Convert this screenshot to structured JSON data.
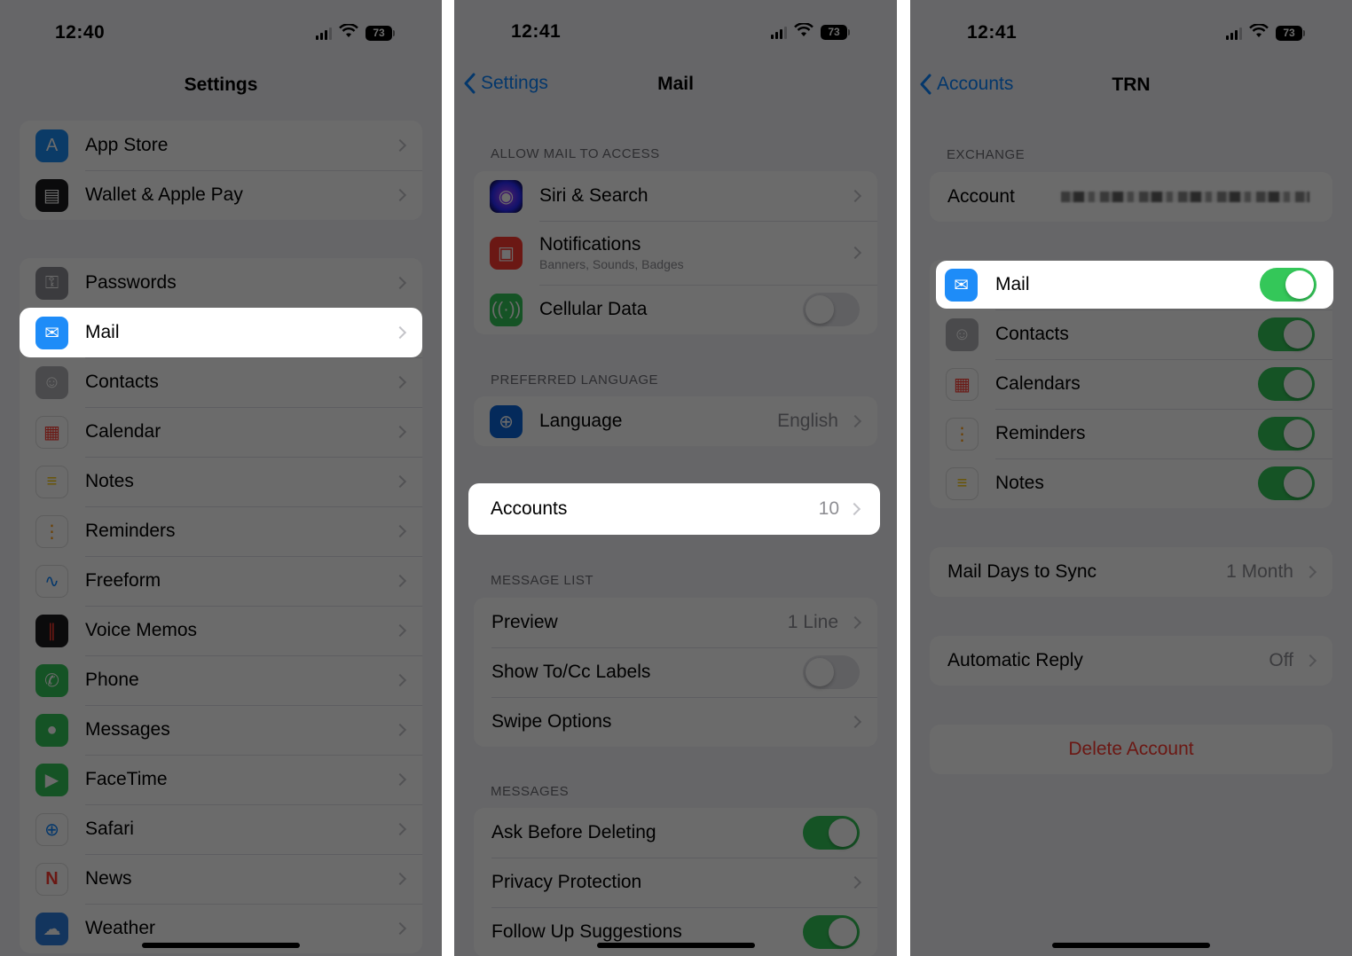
{
  "panel1": {
    "time": "12:40",
    "battery": "73",
    "title": "Settings",
    "items": [
      {
        "label": "App Store",
        "icon": "app-store-icon",
        "color": "#1c8cf6",
        "glyph": "A"
      },
      {
        "label": "Wallet & Apple Pay",
        "icon": "wallet-icon",
        "color": "#1c1c1e",
        "glyph": "▤"
      },
      {
        "label": "Passwords",
        "icon": "key-icon",
        "color": "#8e8e93",
        "glyph": "⚿"
      },
      {
        "label": "Mail",
        "icon": "mail-icon",
        "color": "#1e8cf8",
        "glyph": "✉"
      },
      {
        "label": "Contacts",
        "icon": "contacts-icon",
        "color": "#b0b0b5",
        "glyph": "☺"
      },
      {
        "label": "Calendar",
        "icon": "calendar-icon",
        "color": "#ffffff",
        "glyph": "▦"
      },
      {
        "label": "Notes",
        "icon": "notes-icon",
        "color": "#ffffff",
        "glyph": "≡"
      },
      {
        "label": "Reminders",
        "icon": "reminders-icon",
        "color": "#ffffff",
        "glyph": "⋮"
      },
      {
        "label": "Freeform",
        "icon": "freeform-icon",
        "color": "#ffffff",
        "glyph": "∿"
      },
      {
        "label": "Voice Memos",
        "icon": "voice-memos-icon",
        "color": "#1c1c1e",
        "glyph": "∥"
      },
      {
        "label": "Phone",
        "icon": "phone-icon",
        "color": "#34c759",
        "glyph": "✆"
      },
      {
        "label": "Messages",
        "icon": "messages-icon",
        "color": "#34c759",
        "glyph": "●"
      },
      {
        "label": "FaceTime",
        "icon": "facetime-icon",
        "color": "#34c759",
        "glyph": "▶"
      },
      {
        "label": "Safari",
        "icon": "safari-icon",
        "color": "#ffffff",
        "glyph": "⊕"
      },
      {
        "label": "News",
        "icon": "news-icon",
        "color": "#ffffff",
        "glyph": "N"
      },
      {
        "label": "Weather",
        "icon": "weather-icon",
        "color": "#2f7fe0",
        "glyph": "☁"
      }
    ]
  },
  "panel2": {
    "time": "12:41",
    "battery": "73",
    "back": "Settings",
    "title": "Mail",
    "allow_header": "ALLOW MAIL TO ACCESS",
    "siri": "Siri & Search",
    "notifications": "Notifications",
    "notifications_sub": "Banners, Sounds, Badges",
    "cellular": "Cellular Data",
    "lang_header": "PREFERRED LANGUAGE",
    "language": "Language",
    "language_value": "English",
    "accounts": "Accounts",
    "accounts_count": "10",
    "msglist_header": "MESSAGE LIST",
    "preview": "Preview",
    "preview_value": "1 Line",
    "tocc": "Show To/Cc Labels",
    "swipe": "Swipe Options",
    "messages_header": "MESSAGES",
    "ask_delete": "Ask Before Deleting",
    "privacy": "Privacy Protection",
    "followup": "Follow Up Suggestions"
  },
  "panel3": {
    "time": "12:41",
    "battery": "73",
    "back": "Accounts",
    "title": "TRN",
    "exchange_header": "EXCHANGE",
    "account_label": "Account",
    "mail": "Mail",
    "contacts": "Contacts",
    "calendars": "Calendars",
    "reminders": "Reminders",
    "notes": "Notes",
    "sync": "Mail Days to Sync",
    "sync_value": "1 Month",
    "auto_reply": "Automatic Reply",
    "auto_reply_value": "Off",
    "delete": "Delete Account"
  }
}
